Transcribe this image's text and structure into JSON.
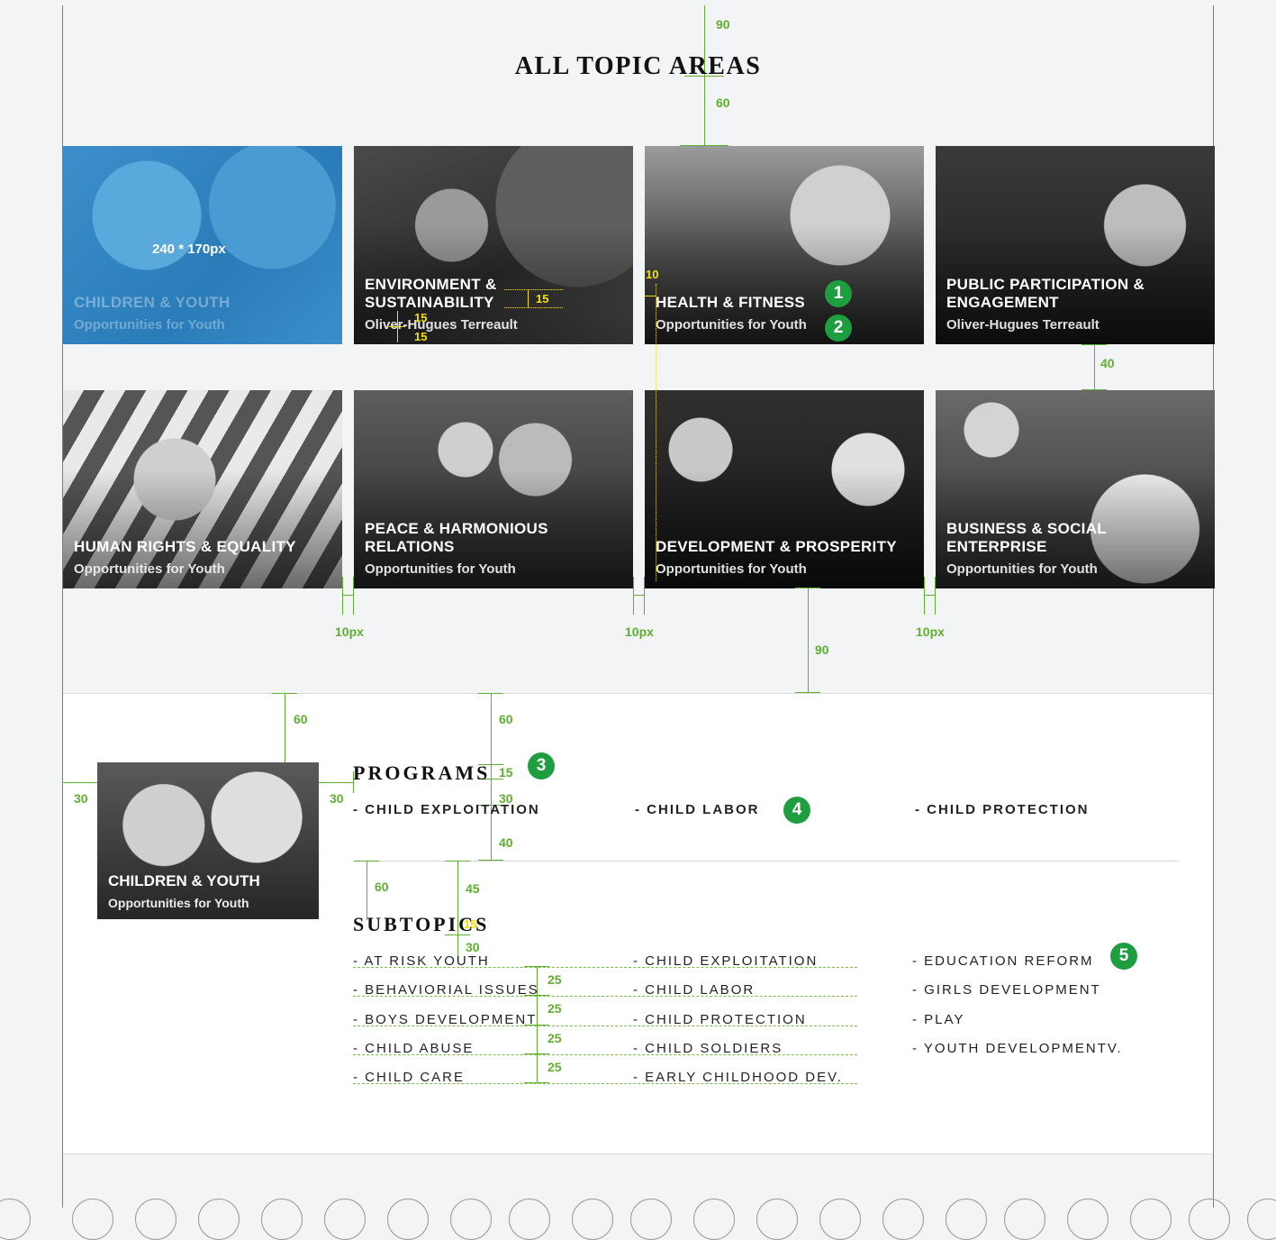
{
  "page": {
    "title": "ALL TOPIC AREAS"
  },
  "colors": {
    "guide": "#5fae2f",
    "highlight": "#f4e100",
    "badge": "#1f9e3f",
    "feature_card": "#3c8fcb"
  },
  "topics": [
    {
      "title": "CHILDREN & YOUTH",
      "subtitle": "Opportunities for Youth",
      "size_note": "240 * 170px"
    },
    {
      "title": "ENVIRONMENT & SUSTAINABILITY",
      "subtitle": "Oliver-Hugues Terreault"
    },
    {
      "title": "HEALTH & FITNESS",
      "subtitle": "Opportunities for Youth"
    },
    {
      "title": "PUBLIC PARTICIPATION & ENGAGEMENT",
      "subtitle": "Oliver-Hugues Terreault"
    },
    {
      "title": "HUMAN RIGHTS & EQUALITY",
      "subtitle": "Opportunities for Youth"
    },
    {
      "title": "PEACE & HARMONIOUS RELATIONS",
      "subtitle": "Opportunities for Youth"
    },
    {
      "title": "DEVELOPMENT & PROSPERITY",
      "subtitle": "Opportunities for Youth"
    },
    {
      "title": "BUSINESS & SOCIAL ENTERPRISE",
      "subtitle": "Opportunities for Youth"
    }
  ],
  "annotations": {
    "top_90": "90",
    "title_60": "60",
    "row_gap_40": "40",
    "gap_10px": "10px",
    "bottom_90": "90",
    "card_15a": "15",
    "card_15b": "15",
    "card_15c": "15",
    "card_10": "10",
    "left_30": "30",
    "mid_30": "30",
    "sec_60a": "60",
    "sec_60b": "60",
    "prog_15": "15",
    "prog_30": "30",
    "prog_40": "40",
    "sub_60": "60",
    "sub_45": "45",
    "sub_15": "15",
    "sub_30": "30",
    "row_25": "25"
  },
  "badges": [
    "1",
    "2",
    "3",
    "4",
    "5"
  ],
  "detail": {
    "thumb": {
      "title": "CHILDREN & YOUTH",
      "subtitle": "Opportunities for Youth"
    },
    "programs": {
      "heading": "PROGRAMS",
      "items": [
        "- CHILD EXPLOITATION",
        "- CHILD LABOR",
        "- CHILD PROTECTION"
      ]
    },
    "subtopics": {
      "heading": "SUBTOPICS",
      "col1": [
        "- AT RISK YOUTH",
        "- BEHAVIORIAL ISSUES",
        "- BOYS DEVELOPMENT",
        "- CHILD ABUSE",
        "- CHILD CARE"
      ],
      "col2": [
        "- CHILD EXPLOITATION",
        "- CHILD LABOR",
        "- CHILD PROTECTION",
        "- CHILD SOLDIERS",
        "- EARLY CHILDHOOD DEV."
      ],
      "col3": [
        "- EDUCATION REFORM",
        "- GIRLS DEVELOPMENT",
        "- PLAY",
        "- YOUTH DEVELOPMENTV."
      ]
    }
  }
}
